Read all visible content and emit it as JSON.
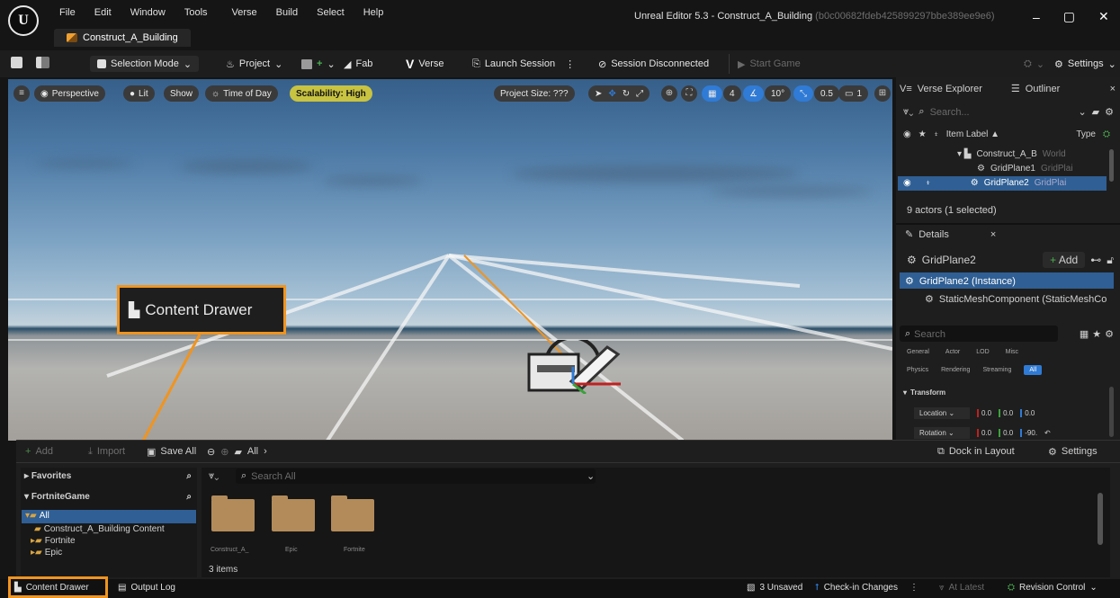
{
  "app": {
    "logo": "U",
    "menu": [
      "File",
      "Edit",
      "Window",
      "Tools",
      "Verse",
      "Build",
      "Select",
      "Help"
    ],
    "project_tab": "Construct_A_Building",
    "window_title": "Unreal Editor 5.3 - Construct_A_Building",
    "window_hash": "(b0c00682fdeb425899297bbe389ee9e6)"
  },
  "toolbar": {
    "selection_mode": "Selection Mode",
    "project": "Project",
    "fab": "Fab",
    "verse": "Verse",
    "launch_session": "Launch Session",
    "session_status": "Session Disconnected",
    "start_game": "Start Game",
    "settings": "Settings"
  },
  "viewport": {
    "perspective": "Perspective",
    "lit": "Lit",
    "show": "Show",
    "time_of_day": "Time of Day",
    "scalability": "Scalability: High",
    "project_size": "Project Size: ???",
    "grid_value": "4",
    "angle_value": "10°",
    "scale_value": "0.5",
    "camera_value": "1"
  },
  "callout": {
    "label": "Content Drawer"
  },
  "outliner": {
    "tab_verse": "Verse Explorer",
    "tab_outliner": "Outliner",
    "search_placeholder": "Search...",
    "col_label": "Item Label ▲",
    "col_type": "Type",
    "rows": [
      {
        "label": "Construct_A_B",
        "type": "World"
      },
      {
        "label": "GridPlane1",
        "type": "GridPlai"
      },
      {
        "label": "GridPlane2",
        "type": "GridPlai"
      }
    ],
    "count": "9 actors (1 selected)"
  },
  "details": {
    "tab": "Details",
    "object": "GridPlane2",
    "add": "Add",
    "instance": "GridPlane2 (Instance)",
    "component": "StaticMeshComponent (StaticMeshCo",
    "search_placeholder": "Search",
    "filters_row1": [
      "General",
      "Actor",
      "LOD",
      "Misc"
    ],
    "filters_row2": [
      "Physics",
      "Rendering",
      "Streaming",
      "All"
    ],
    "transform": "Transform",
    "location_label": "Location",
    "rotation_label": "Rotation",
    "location_values": [
      "0.0",
      "0.0",
      "0.0"
    ],
    "rotation_values": [
      "0.0",
      "0.0",
      "-90."
    ]
  },
  "drawer": {
    "add": "Add",
    "import": "Import",
    "save_all": "Save All",
    "path_root": "All",
    "dock": "Dock in Layout",
    "settings": "Settings",
    "favorites": "Favorites",
    "fortnite_game": "FortniteGame",
    "tree": [
      "All",
      "Construct_A_Building Content",
      "Fortnite",
      "Epic"
    ],
    "search_placeholder": "Search All",
    "folders": [
      {
        "name": "Construct_A_"
      },
      {
        "name": "Epic"
      },
      {
        "name": "Fortnite"
      }
    ],
    "item_count": "3 items"
  },
  "statusbar": {
    "content_drawer": "Content Drawer",
    "output_log": "Output Log",
    "unsaved": "3 Unsaved",
    "checkin": "Check-in Changes",
    "at_latest": "At Latest",
    "revision_control": "Revision Control"
  },
  "colors": {
    "highlight": "#f0941f",
    "selection": "#2f5f94",
    "accent_blue": "#2f7bd6",
    "scalability": "#c8c341"
  }
}
